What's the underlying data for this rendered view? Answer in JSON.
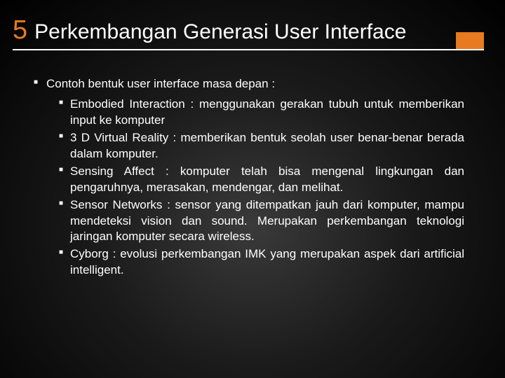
{
  "title": {
    "number": "5",
    "text": "Perkembangan Generasi User Interface"
  },
  "mainBullet": "Contoh bentuk user interface masa depan :",
  "subItems": [
    "Embodied Interaction : menggunakan gerakan tubuh untuk memberikan input ke komputer",
    "3 D Virtual Reality : memberikan bentuk seolah user benar-benar berada dalam komputer.",
    "Sensing Affect : komputer telah bisa mengenal lingkungan dan pengaruhnya, merasakan, mendengar, dan melihat.",
    "Sensor Networks : sensor yang ditempatkan jauh dari komputer, mampu mendeteksi vision dan sound. Merupakan perkembangan teknologi jaringan komputer secara wireless.",
    "Cyborg : evolusi perkembangan IMK yang merupakan aspek dari artificial intelligent."
  ]
}
